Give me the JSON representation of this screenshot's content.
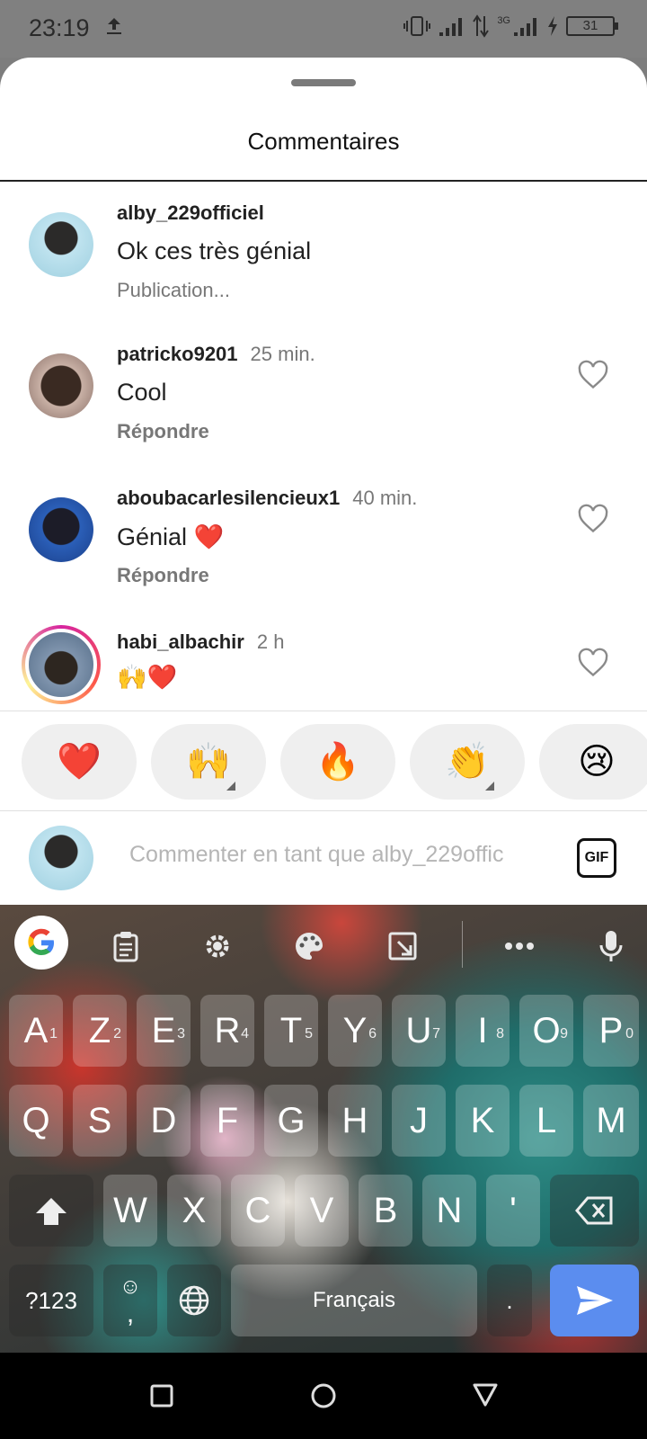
{
  "status_bar": {
    "time": "23:19",
    "network": "3G",
    "battery": "31"
  },
  "sheet": {
    "title": "Commentaires"
  },
  "comments": [
    {
      "user": "alby_229officiel",
      "age": "",
      "text": "Ok ces très génial",
      "action": "Publication..."
    },
    {
      "user": "patricko9201",
      "age": "25 min.",
      "text": "Cool",
      "action": "Répondre"
    },
    {
      "user": "aboubacarlesilencieux1",
      "age": "40 min.",
      "text": "Génial ❤️",
      "action": "Répondre"
    },
    {
      "user": "habi_albachir",
      "age": "2 h",
      "text": "🙌❤️",
      "action": ""
    }
  ],
  "quick_reactions": [
    "❤️",
    "🙌",
    "🔥",
    "👏",
    "😢"
  ],
  "composer": {
    "placeholder": "Commenter en tant que alby_229offic",
    "gif_label": "GIF"
  },
  "keyboard": {
    "row1": [
      "A",
      "Z",
      "E",
      "R",
      "T",
      "Y",
      "U",
      "I",
      "O",
      "P"
    ],
    "row1_numbers": [
      "1",
      "2",
      "3",
      "4",
      "5",
      "6",
      "7",
      "8",
      "9",
      "0"
    ],
    "row2": [
      "Q",
      "S",
      "D",
      "F",
      "G",
      "H",
      "J",
      "K",
      "L",
      "M"
    ],
    "row3": [
      "W",
      "X",
      "C",
      "V",
      "B",
      "N",
      "'"
    ],
    "symbols_key": "?123",
    "emoji_key": "☺",
    "comma_key": ",",
    "space_label": "Français",
    "period_key": "."
  },
  "colors": {
    "accent_send": "#5b8def",
    "heart": "#e0232e"
  }
}
